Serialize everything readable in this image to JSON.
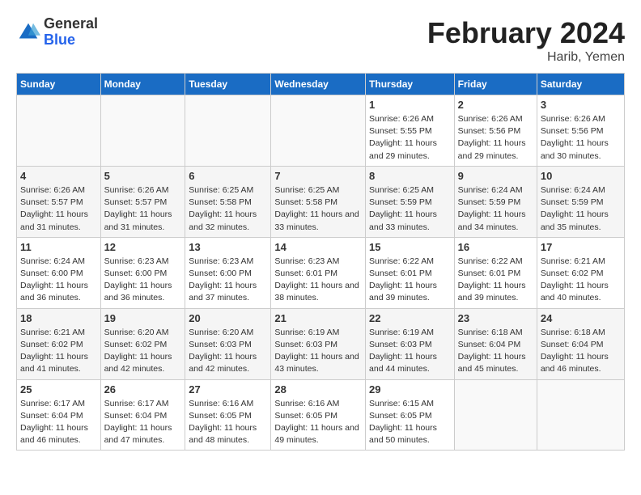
{
  "header": {
    "logo_general": "General",
    "logo_blue": "Blue",
    "month_title": "February 2024",
    "location": "Harib, Yemen"
  },
  "weekdays": [
    "Sunday",
    "Monday",
    "Tuesday",
    "Wednesday",
    "Thursday",
    "Friday",
    "Saturday"
  ],
  "weeks": [
    [
      {
        "day": "",
        "sunrise": "",
        "sunset": "",
        "daylight": "",
        "empty": true
      },
      {
        "day": "",
        "sunrise": "",
        "sunset": "",
        "daylight": "",
        "empty": true
      },
      {
        "day": "",
        "sunrise": "",
        "sunset": "",
        "daylight": "",
        "empty": true
      },
      {
        "day": "",
        "sunrise": "",
        "sunset": "",
        "daylight": "",
        "empty": true
      },
      {
        "day": "1",
        "sunrise": "Sunrise: 6:26 AM",
        "sunset": "Sunset: 5:55 PM",
        "daylight": "Daylight: 11 hours and 29 minutes.",
        "empty": false
      },
      {
        "day": "2",
        "sunrise": "Sunrise: 6:26 AM",
        "sunset": "Sunset: 5:56 PM",
        "daylight": "Daylight: 11 hours and 29 minutes.",
        "empty": false
      },
      {
        "day": "3",
        "sunrise": "Sunrise: 6:26 AM",
        "sunset": "Sunset: 5:56 PM",
        "daylight": "Daylight: 11 hours and 30 minutes.",
        "empty": false
      }
    ],
    [
      {
        "day": "4",
        "sunrise": "Sunrise: 6:26 AM",
        "sunset": "Sunset: 5:57 PM",
        "daylight": "Daylight: 11 hours and 31 minutes.",
        "empty": false
      },
      {
        "day": "5",
        "sunrise": "Sunrise: 6:26 AM",
        "sunset": "Sunset: 5:57 PM",
        "daylight": "Daylight: 11 hours and 31 minutes.",
        "empty": false
      },
      {
        "day": "6",
        "sunrise": "Sunrise: 6:25 AM",
        "sunset": "Sunset: 5:58 PM",
        "daylight": "Daylight: 11 hours and 32 minutes.",
        "empty": false
      },
      {
        "day": "7",
        "sunrise": "Sunrise: 6:25 AM",
        "sunset": "Sunset: 5:58 PM",
        "daylight": "Daylight: 11 hours and 33 minutes.",
        "empty": false
      },
      {
        "day": "8",
        "sunrise": "Sunrise: 6:25 AM",
        "sunset": "Sunset: 5:59 PM",
        "daylight": "Daylight: 11 hours and 33 minutes.",
        "empty": false
      },
      {
        "day": "9",
        "sunrise": "Sunrise: 6:24 AM",
        "sunset": "Sunset: 5:59 PM",
        "daylight": "Daylight: 11 hours and 34 minutes.",
        "empty": false
      },
      {
        "day": "10",
        "sunrise": "Sunrise: 6:24 AM",
        "sunset": "Sunset: 5:59 PM",
        "daylight": "Daylight: 11 hours and 35 minutes.",
        "empty": false
      }
    ],
    [
      {
        "day": "11",
        "sunrise": "Sunrise: 6:24 AM",
        "sunset": "Sunset: 6:00 PM",
        "daylight": "Daylight: 11 hours and 36 minutes.",
        "empty": false
      },
      {
        "day": "12",
        "sunrise": "Sunrise: 6:23 AM",
        "sunset": "Sunset: 6:00 PM",
        "daylight": "Daylight: 11 hours and 36 minutes.",
        "empty": false
      },
      {
        "day": "13",
        "sunrise": "Sunrise: 6:23 AM",
        "sunset": "Sunset: 6:00 PM",
        "daylight": "Daylight: 11 hours and 37 minutes.",
        "empty": false
      },
      {
        "day": "14",
        "sunrise": "Sunrise: 6:23 AM",
        "sunset": "Sunset: 6:01 PM",
        "daylight": "Daylight: 11 hours and 38 minutes.",
        "empty": false
      },
      {
        "day": "15",
        "sunrise": "Sunrise: 6:22 AM",
        "sunset": "Sunset: 6:01 PM",
        "daylight": "Daylight: 11 hours and 39 minutes.",
        "empty": false
      },
      {
        "day": "16",
        "sunrise": "Sunrise: 6:22 AM",
        "sunset": "Sunset: 6:01 PM",
        "daylight": "Daylight: 11 hours and 39 minutes.",
        "empty": false
      },
      {
        "day": "17",
        "sunrise": "Sunrise: 6:21 AM",
        "sunset": "Sunset: 6:02 PM",
        "daylight": "Daylight: 11 hours and 40 minutes.",
        "empty": false
      }
    ],
    [
      {
        "day": "18",
        "sunrise": "Sunrise: 6:21 AM",
        "sunset": "Sunset: 6:02 PM",
        "daylight": "Daylight: 11 hours and 41 minutes.",
        "empty": false
      },
      {
        "day": "19",
        "sunrise": "Sunrise: 6:20 AM",
        "sunset": "Sunset: 6:02 PM",
        "daylight": "Daylight: 11 hours and 42 minutes.",
        "empty": false
      },
      {
        "day": "20",
        "sunrise": "Sunrise: 6:20 AM",
        "sunset": "Sunset: 6:03 PM",
        "daylight": "Daylight: 11 hours and 42 minutes.",
        "empty": false
      },
      {
        "day": "21",
        "sunrise": "Sunrise: 6:19 AM",
        "sunset": "Sunset: 6:03 PM",
        "daylight": "Daylight: 11 hours and 43 minutes.",
        "empty": false
      },
      {
        "day": "22",
        "sunrise": "Sunrise: 6:19 AM",
        "sunset": "Sunset: 6:03 PM",
        "daylight": "Daylight: 11 hours and 44 minutes.",
        "empty": false
      },
      {
        "day": "23",
        "sunrise": "Sunrise: 6:18 AM",
        "sunset": "Sunset: 6:04 PM",
        "daylight": "Daylight: 11 hours and 45 minutes.",
        "empty": false
      },
      {
        "day": "24",
        "sunrise": "Sunrise: 6:18 AM",
        "sunset": "Sunset: 6:04 PM",
        "daylight": "Daylight: 11 hours and 46 minutes.",
        "empty": false
      }
    ],
    [
      {
        "day": "25",
        "sunrise": "Sunrise: 6:17 AM",
        "sunset": "Sunset: 6:04 PM",
        "daylight": "Daylight: 11 hours and 46 minutes.",
        "empty": false
      },
      {
        "day": "26",
        "sunrise": "Sunrise: 6:17 AM",
        "sunset": "Sunset: 6:04 PM",
        "daylight": "Daylight: 11 hours and 47 minutes.",
        "empty": false
      },
      {
        "day": "27",
        "sunrise": "Sunrise: 6:16 AM",
        "sunset": "Sunset: 6:05 PM",
        "daylight": "Daylight: 11 hours and 48 minutes.",
        "empty": false
      },
      {
        "day": "28",
        "sunrise": "Sunrise: 6:16 AM",
        "sunset": "Sunset: 6:05 PM",
        "daylight": "Daylight: 11 hours and 49 minutes.",
        "empty": false
      },
      {
        "day": "29",
        "sunrise": "Sunrise: 6:15 AM",
        "sunset": "Sunset: 6:05 PM",
        "daylight": "Daylight: 11 hours and 50 minutes.",
        "empty": false
      },
      {
        "day": "",
        "sunrise": "",
        "sunset": "",
        "daylight": "",
        "empty": true
      },
      {
        "day": "",
        "sunrise": "",
        "sunset": "",
        "daylight": "",
        "empty": true
      }
    ]
  ]
}
